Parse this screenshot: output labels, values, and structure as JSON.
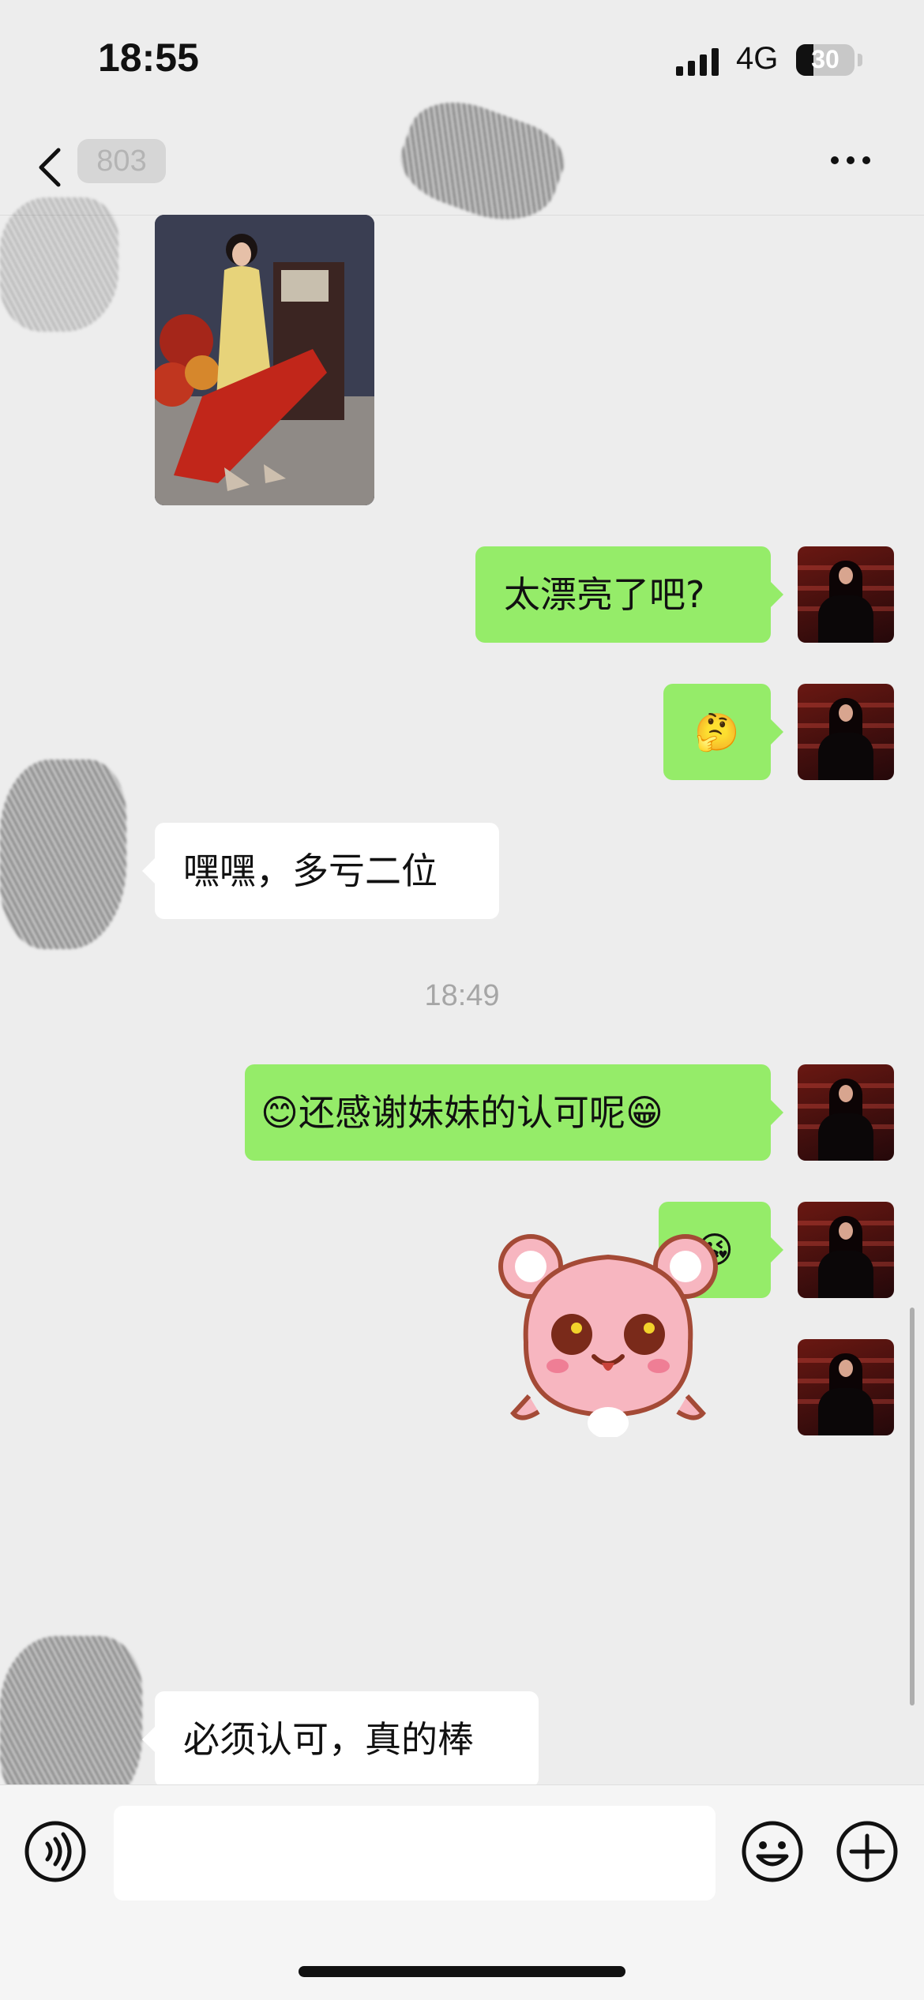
{
  "status_bar": {
    "time": "18:55",
    "network": "4G",
    "battery": "30",
    "battery_level": 0.3
  },
  "header": {
    "title": "803",
    "back_icon": "chevron-left-icon",
    "more_icon": "more-icon"
  },
  "messages": [
    {
      "type": "image",
      "sender": "contact"
    },
    {
      "type": "text",
      "sender": "me",
      "text": "太漂亮了吧?"
    },
    {
      "type": "text",
      "sender": "me",
      "text": "🤔"
    },
    {
      "type": "text",
      "sender": "contact",
      "text": "嘿嘿，多亏二位"
    },
    {
      "type": "timestamp",
      "text": "18:49"
    },
    {
      "type": "text",
      "sender": "me",
      "text": "😊还感谢妹妹的认可呢😁"
    },
    {
      "type": "text",
      "sender": "me",
      "text": "😘"
    },
    {
      "type": "sticker",
      "sender": "me",
      "sticker": "pink-bear-sticker"
    },
    {
      "type": "text",
      "sender": "contact",
      "text": "必须认可，真的棒"
    }
  ],
  "input_bar": {
    "voice_icon": "voice-icon",
    "input_value": "",
    "emoji_icon": "emoji-icon",
    "plus_icon": "plus-icon"
  },
  "colors": {
    "my_bubble": "#95ec69",
    "their_bubble": "#ffffff",
    "background": "#ededed"
  }
}
